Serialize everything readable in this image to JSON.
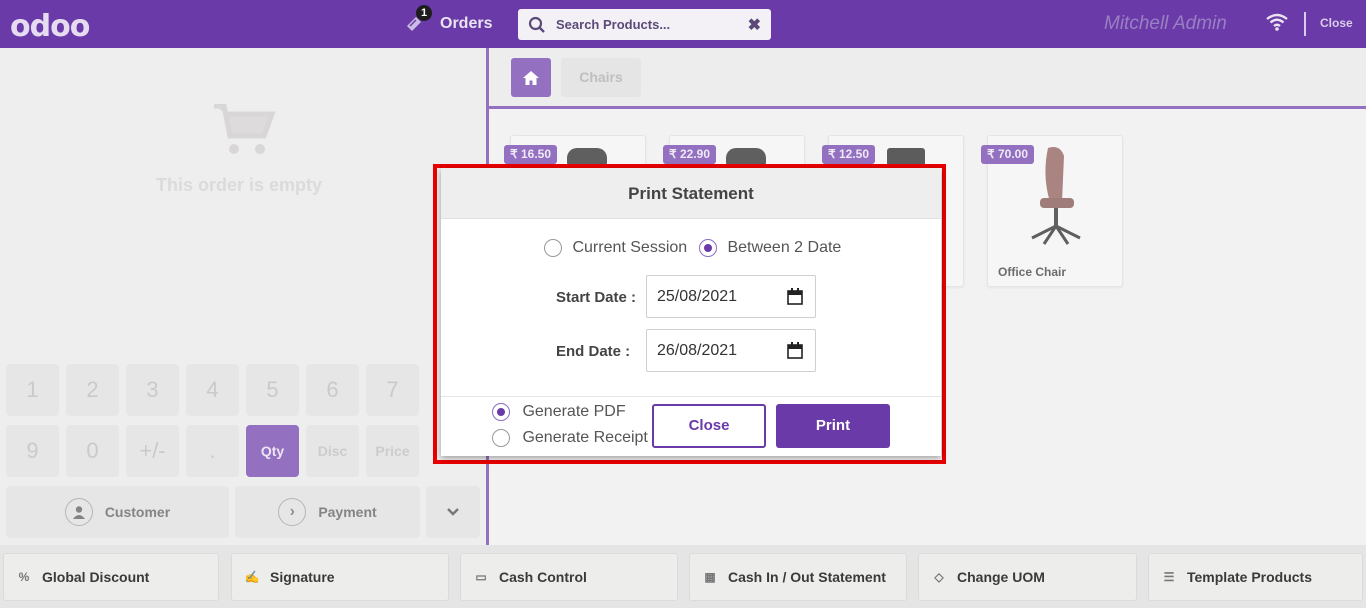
{
  "topbar": {
    "logo": "odoo",
    "orders_label": "Orders",
    "orders_count": "1",
    "search_placeholder": "Search Products...",
    "user": "Mitchell Admin",
    "close_label": "Close"
  },
  "order": {
    "empty_text": "This order is empty"
  },
  "numpad": {
    "row1": [
      "1",
      "2",
      "3",
      "4",
      "5",
      "6",
      "7"
    ],
    "row2": [
      "9",
      "0",
      "+/-",
      ".",
      "Qty",
      "Disc",
      "Price"
    ],
    "customer_label": "Customer",
    "payment_label": "Payment"
  },
  "categories": {
    "current": "Chairs"
  },
  "products": [
    {
      "price": "₹ 16.50"
    },
    {
      "price": "₹ 22.90"
    },
    {
      "price": "₹ 12.50"
    },
    {
      "price": "₹ 70.00",
      "name": "Office Chair"
    }
  ],
  "bottom_buttons": [
    {
      "label": "Global Discount",
      "icon": "percent-icon"
    },
    {
      "label": "Signature",
      "icon": "signature-icon"
    },
    {
      "label": "Cash Control",
      "icon": "money-icon"
    },
    {
      "label": "Cash In / Out Statement",
      "icon": "calculator-icon"
    },
    {
      "label": "Change UOM",
      "icon": "tag-icon"
    },
    {
      "label": "Template Products",
      "icon": "list-icon"
    }
  ],
  "modal": {
    "title": "Print Statement",
    "option_current": "Current Session",
    "option_between": "Between 2 Date",
    "selected_period": "Between 2 Date",
    "start_label": "Start Date :",
    "start_value": "25/08/2021",
    "end_label": "End Date :",
    "end_value": "26/08/2021",
    "output_pdf": "Generate PDF",
    "output_receipt": "Generate Receipt",
    "selected_output": "Generate PDF",
    "close_label": "Close",
    "print_label": "Print"
  },
  "colors": {
    "brand": "#6a3aa8",
    "highlight": "#e80000"
  }
}
